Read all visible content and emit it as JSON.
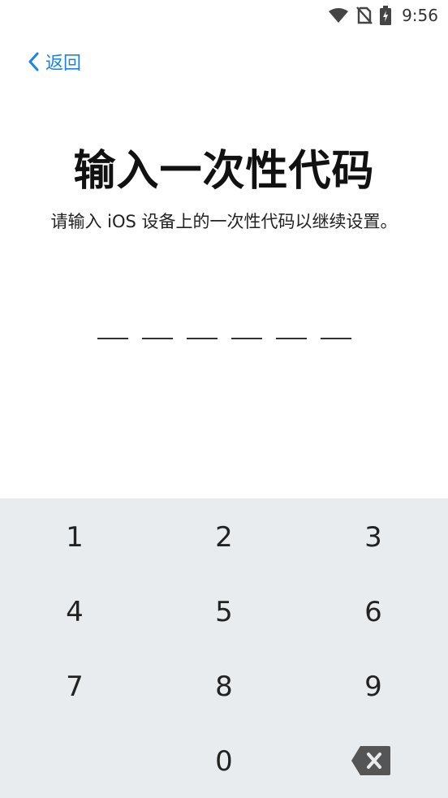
{
  "status_bar": {
    "time": "9:56",
    "icons": [
      "wifi-icon",
      "no-sim-icon",
      "battery-charging-icon"
    ]
  },
  "nav": {
    "back_label": "返回"
  },
  "header": {
    "title": "输入一次性代码",
    "subtitle": "请输入 iOS 设备上的一次性代码以继续设置。"
  },
  "code": {
    "slot_count": 6,
    "value": ""
  },
  "keypad": {
    "keys": [
      "1",
      "2",
      "3",
      "4",
      "5",
      "6",
      "7",
      "8",
      "9",
      "0"
    ],
    "delete_icon": "backspace-icon",
    "background_color": "#e8ecef"
  },
  "colors": {
    "accent": "#1a82e8"
  }
}
